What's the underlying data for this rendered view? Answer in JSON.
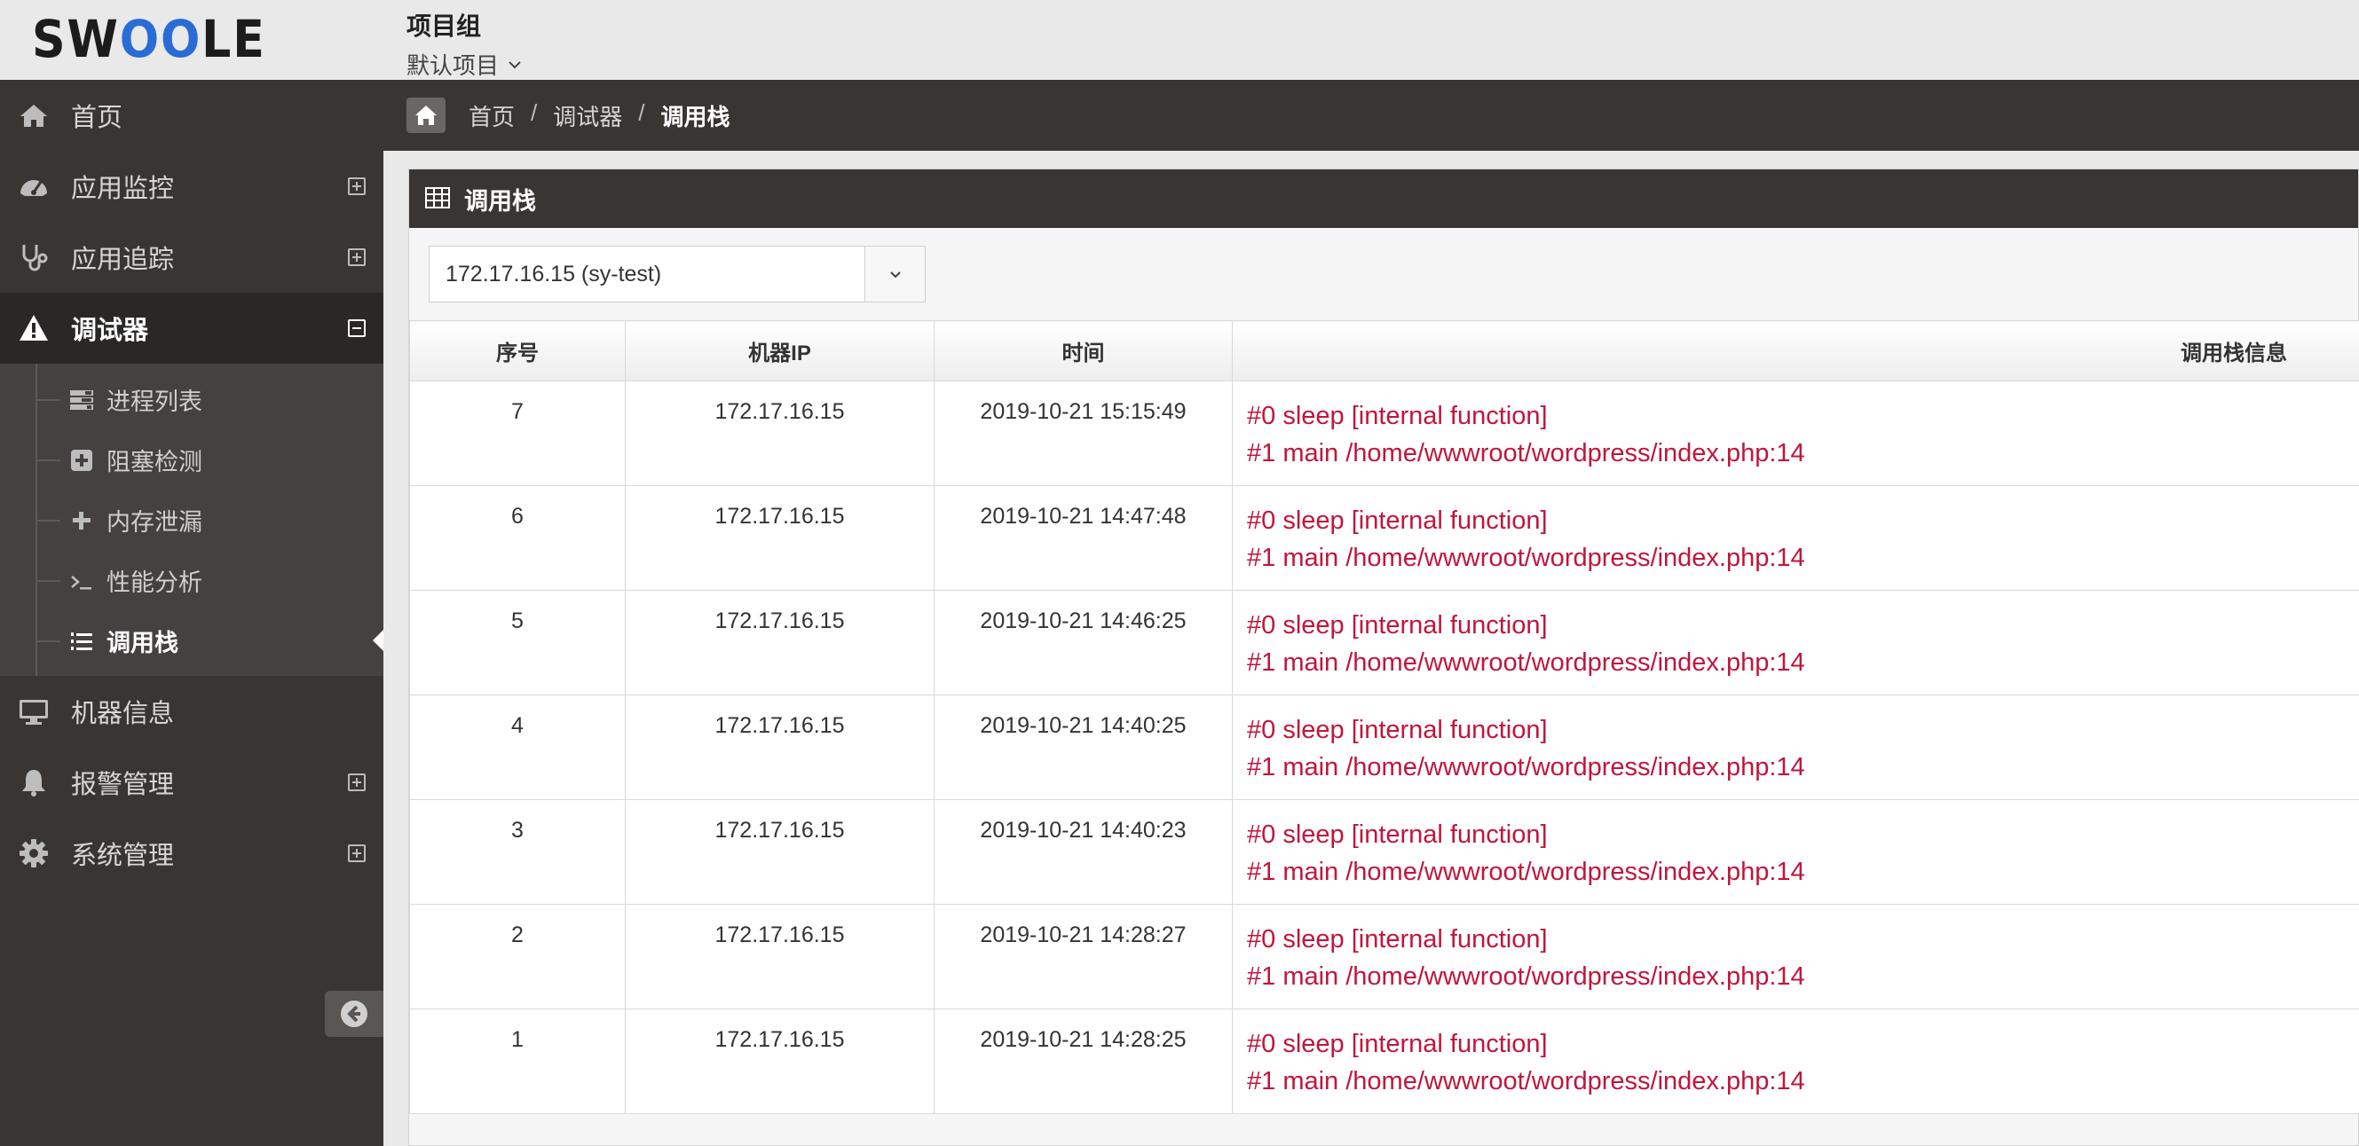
{
  "logo": {
    "text_left": "SW",
    "text_mid": "OO",
    "text_right": "LE"
  },
  "project": {
    "title": "项目组",
    "current": "默认项目"
  },
  "sidebar": {
    "items": [
      {
        "label": "首页",
        "icon": "home-icon"
      },
      {
        "label": "应用监控",
        "icon": "dashboard-icon"
      },
      {
        "label": "应用追踪",
        "icon": "stethoscope-icon"
      },
      {
        "label": "调试器",
        "icon": "warning-icon"
      },
      {
        "label": "机器信息",
        "icon": "desktop-icon"
      },
      {
        "label": "报警管理",
        "icon": "bell-icon"
      },
      {
        "label": "系统管理",
        "icon": "gear-icon"
      }
    ],
    "subitems": [
      {
        "label": "进程列表",
        "icon": "tasks-icon"
      },
      {
        "label": "阻塞检测",
        "icon": "plus-square-icon"
      },
      {
        "label": "内存泄漏",
        "icon": "plus-icon"
      },
      {
        "label": "性能分析",
        "icon": "terminal-icon"
      },
      {
        "label": "调用栈",
        "icon": "list-ol-icon"
      }
    ]
  },
  "breadcrumb": {
    "home": "首页",
    "middle": "调试器",
    "current": "调用栈",
    "separator": "/"
  },
  "panel": {
    "title": "调用栈",
    "select_value": "172.17.16.15 (sy-test)",
    "columns": [
      "序号",
      "机器IP",
      "时间",
      "调用栈信息"
    ],
    "rows": [
      {
        "no": "7",
        "ip": "172.17.16.15",
        "time": "2019-10-21 15:15:49",
        "line1": "#0 sleep [internal function]",
        "line2": "#1 main /home/wwwroot/wordpress/index.php:14"
      },
      {
        "no": "6",
        "ip": "172.17.16.15",
        "time": "2019-10-21 14:47:48",
        "line1": "#0 sleep [internal function]",
        "line2": "#1 main /home/wwwroot/wordpress/index.php:14"
      },
      {
        "no": "5",
        "ip": "172.17.16.15",
        "time": "2019-10-21 14:46:25",
        "line1": "#0 sleep [internal function]",
        "line2": "#1 main /home/wwwroot/wordpress/index.php:14"
      },
      {
        "no": "4",
        "ip": "172.17.16.15",
        "time": "2019-10-21 14:40:25",
        "line1": "#0 sleep [internal function]",
        "line2": "#1 main /home/wwwroot/wordpress/index.php:14"
      },
      {
        "no": "3",
        "ip": "172.17.16.15",
        "time": "2019-10-21 14:40:23",
        "line1": "#0 sleep [internal function]",
        "line2": "#1 main /home/wwwroot/wordpress/index.php:14"
      },
      {
        "no": "2",
        "ip": "172.17.16.15",
        "time": "2019-10-21 14:28:27",
        "line1": "#0 sleep [internal function]",
        "line2": "#1 main /home/wwwroot/wordpress/index.php:14"
      },
      {
        "no": "1",
        "ip": "172.17.16.15",
        "time": "2019-10-21 14:28:25",
        "line1": "#0 sleep [internal function]",
        "line2": "#1 main /home/wwwroot/wordpress/index.php:14"
      }
    ]
  },
  "colors": {
    "sidebar_bg": "#393533",
    "stack_text": "#c0163c",
    "logo_accent": "#2a6cd6"
  }
}
